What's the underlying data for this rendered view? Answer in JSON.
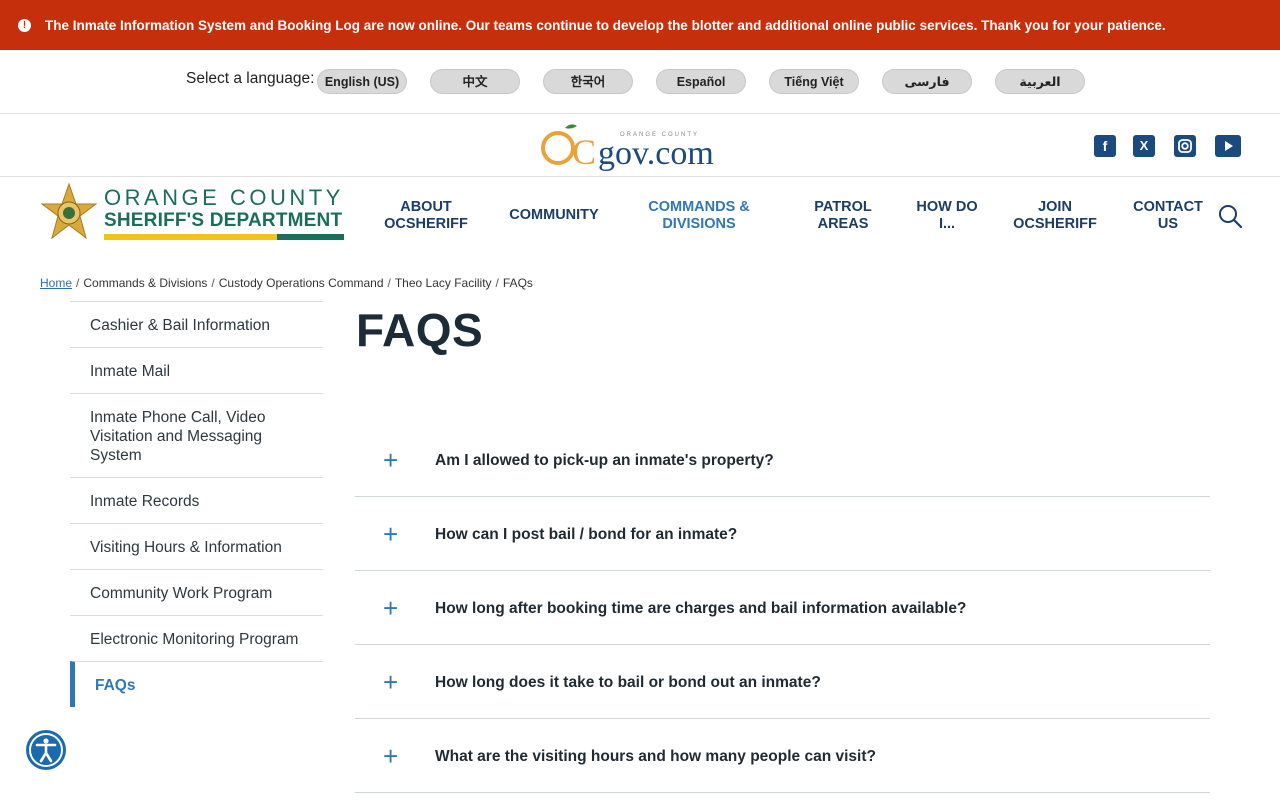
{
  "alert": {
    "icon": "alert-icon",
    "text": "The Inmate Information System and Booking Log are now online. Our teams continue to develop the blotter and additional online public services. Thank you for your patience."
  },
  "language": {
    "label": "Select a language:",
    "options": [
      "English (US)",
      "中文",
      "한국어",
      "Español",
      "Tiếng Việt",
      "فارسی",
      "العربية"
    ]
  },
  "ocgov": {
    "small_text": "ORANGE COUNTY",
    "logo_text": "gov.com"
  },
  "social": [
    "facebook-icon",
    "x-icon",
    "instagram-icon",
    "youtube-icon"
  ],
  "department": {
    "line1": "ORANGE COUNTY",
    "line2": "SHERIFF'S DEPARTMENT"
  },
  "nav": {
    "items": [
      {
        "label": "About OCSheriff"
      },
      {
        "label": "Community"
      },
      {
        "label": "Commands & Divisions"
      },
      {
        "label": "Patrol Areas"
      },
      {
        "label": "How Do I..."
      },
      {
        "label": "Join OCSheriff"
      },
      {
        "label": "Contact Us"
      }
    ]
  },
  "breadcrumb": [
    "Home",
    "Commands & Divisions",
    "Custody Operations Command",
    "Theo Lacy Facility",
    "FAQs"
  ],
  "sidebar": {
    "items": [
      "Cashier & Bail Information",
      "Inmate Mail",
      "Inmate Phone Call, Video Visitation and Messaging System",
      "Inmate Records",
      "Visiting Hours & Information",
      "Community Work Program",
      "Electronic Monitoring Program",
      "FAQs"
    ]
  },
  "page": {
    "title": "FAQS"
  },
  "faqs": [
    "Am I allowed to pick-up an inmate's property?",
    "How can I post bail / bond for an inmate?",
    "How long after booking time are charges and bail information available?",
    "How long does it take to bail or bond out an inmate?",
    "What are the visiting hours and how many people can visit?"
  ],
  "colors": {
    "alert_bg": "#c62f0c",
    "nav_text": "#1a3e66",
    "accent": "#2f78b5",
    "brand_green": "#1b6e5a"
  }
}
